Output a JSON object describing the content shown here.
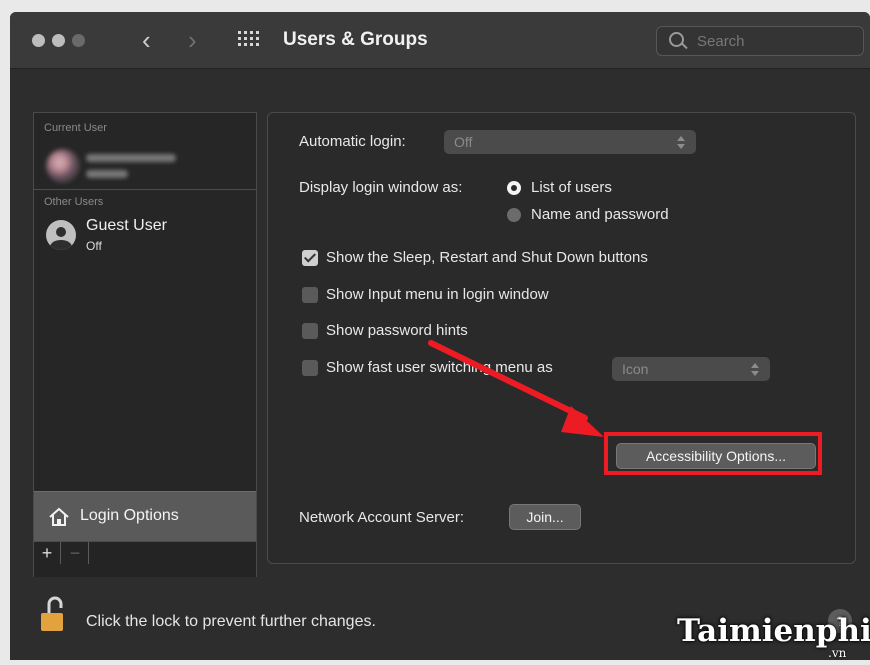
{
  "window": {
    "title": "Users & Groups",
    "search_placeholder": "Search"
  },
  "sidebar": {
    "current_user_label": "Current User",
    "other_users_label": "Other Users",
    "guest_user": {
      "name": "Guest User",
      "status": "Off"
    },
    "login_options_label": "Login Options",
    "add_button": "+",
    "remove_button": "−"
  },
  "main": {
    "automatic_login_label": "Automatic login:",
    "automatic_login_value": "Off",
    "display_login_window_label": "Display login window as:",
    "display_options": [
      {
        "label": "List of users",
        "selected": true
      },
      {
        "label": "Name and password",
        "selected": false
      }
    ],
    "checkboxes": [
      {
        "label": "Show the Sleep, Restart and Shut Down buttons",
        "checked": true
      },
      {
        "label": "Show Input menu in login window",
        "checked": false
      },
      {
        "label": "Show password hints",
        "checked": false
      },
      {
        "label": "Show fast user switching menu as",
        "checked": false
      }
    ],
    "fast_user_switching_value": "Icon",
    "accessibility_button": "Accessibility Options...",
    "network_account_server_label": "Network Account Server:",
    "join_button": "Join..."
  },
  "footer": {
    "lock_text": "Click the lock to prevent further changes.",
    "help_button": "?"
  },
  "watermark": {
    "text": "Taimienphi",
    "sub": ".vn"
  },
  "colors": {
    "highlight": "#ed1c24",
    "arrow": "#ed1c24",
    "lock": "#e2a23e"
  }
}
